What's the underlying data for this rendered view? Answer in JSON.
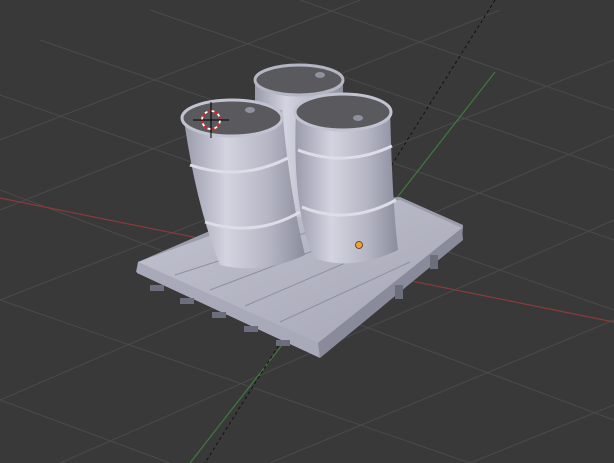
{
  "viewport": {
    "background": "#393939",
    "grid_color": "#4a4a4a",
    "x_axis_color": "#8a3a3a",
    "y_axis_color": "#3e7a3e",
    "view_line_color": "#111111"
  },
  "scene": {
    "objects": [
      "pallet",
      "barrel-front-left",
      "barrel-back",
      "barrel-front-right"
    ],
    "object_color": "#b5b6c4",
    "object_shadow": "#8f90a0",
    "lid_color": "#5a5a5e",
    "origin_color": "#f0a030",
    "cursor_icon": "3d-cursor-icon"
  }
}
